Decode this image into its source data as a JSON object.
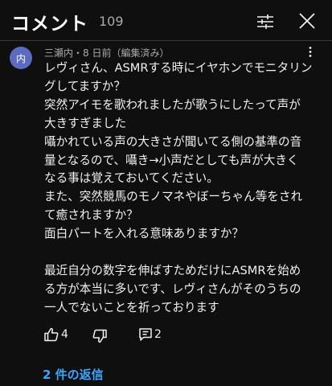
{
  "header": {
    "title": "コメント",
    "count": "109",
    "filter_icon": "sliders-icon",
    "close_icon": "close-icon"
  },
  "comment": {
    "avatar_initial": "内",
    "avatar_color": "#5c6bc0",
    "meta": "三瀬内・8 日前（編集済み）",
    "lines": [
      "レヴィさん、ASMRする時にイヤホンでモニタリン",
      "グしてますか？",
      "突然アイモを歌われましたが歌うにしたって声が",
      "大きすぎました",
      "囁かれている声の大きさが聞いてる側の基準の音",
      "量となるので、囁き→小声だとしても声が大きく",
      "なる事は覚えておいてください。",
      "また、突然競馬のモノマネやぼーちゃん等をされ",
      "て癒されますか？",
      "面白パートを入れる意味ありますか？",
      "",
      "最近自分の数字を伸ばすためだけにASMRを始め",
      "る方が本当に多いです、レヴィさんがそのうちの",
      "一人でないことを祈っております"
    ],
    "like_count": "4",
    "reply_count": "2",
    "replies_link": "2 件の返信"
  },
  "colors": {
    "background": "#0f0f0f",
    "text": "#f1f1f1",
    "secondary_text": "#aaaaaa",
    "link": "#3ea6ff"
  }
}
